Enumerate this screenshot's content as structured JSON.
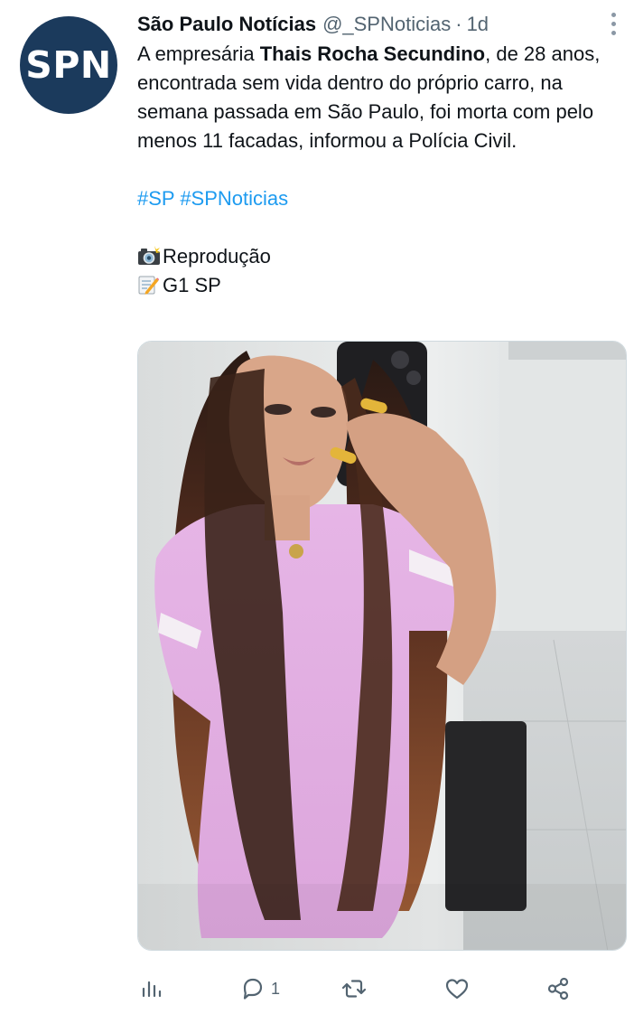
{
  "tweet": {
    "avatar_text": "SPN",
    "display_name": "São Paulo Notícias",
    "handle": "@_SPNoticias",
    "separator": "·",
    "time": "1d",
    "text_pre": "A empresária ",
    "text_bold": "Thais Rocha Secundino",
    "text_post": ", de 28 anos, encontrada sem vida dentro do próprio carro, na semana passada em São Paulo, foi morta com pelo menos 11 facadas, informou a Polícia Civil.",
    "hashtags": [
      "#SP",
      "#SPNoticias"
    ],
    "credit_photo": "Reprodução",
    "credit_source": "G1 SP",
    "icons": {
      "credit_photo": "camera-flash-icon",
      "credit_source": "memo-icon",
      "more": "more-options-icon"
    }
  },
  "actions": [
    {
      "name": "analytics-icon"
    },
    {
      "name": "reply-icon",
      "count": "1"
    },
    {
      "name": "retweet-icon"
    },
    {
      "name": "like-icon"
    },
    {
      "name": "share-icon"
    }
  ],
  "colors": {
    "brand_avatar": "#1b3a5c",
    "link": "#1d9bf0",
    "text": "#0f1419",
    "secondary": "#536471"
  }
}
